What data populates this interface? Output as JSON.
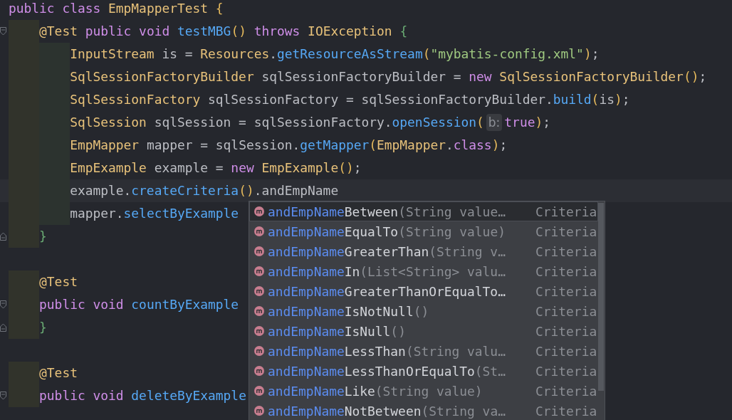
{
  "editor": {
    "lines": [
      {
        "tokens": [
          {
            "kind": "kw",
            "text": "public class "
          },
          {
            "kind": "type",
            "text": "EmpMapperTest "
          },
          {
            "kind": "brace-y",
            "text": "{"
          }
        ],
        "children": [
          {
            "fold_start": true,
            "tokens": [
              {
                "kind": "ann",
                "text": "@Test "
              },
              {
                "kind": "kw",
                "text": "public void "
              },
              {
                "kind": "method",
                "text": "testMBG"
              },
              {
                "kind": "paren",
                "text": "()"
              },
              {
                "kind": "kw",
                "text": " throws "
              },
              {
                "kind": "type",
                "text": "IOException "
              },
              {
                "kind": "brace-g",
                "text": "{"
              }
            ],
            "children": [
              {
                "tokens": [
                  {
                    "kind": "type",
                    "text": "InputStream "
                  },
                  {
                    "kind": "plain",
                    "text": "is = "
                  },
                  {
                    "kind": "type",
                    "text": "Resources"
                  },
                  {
                    "kind": "plain",
                    "text": "."
                  },
                  {
                    "kind": "method",
                    "text": "getResourceAsStream"
                  },
                  {
                    "kind": "paren",
                    "text": "("
                  },
                  {
                    "kind": "str",
                    "text": "\"mybatis-config.xml\""
                  },
                  {
                    "kind": "paren",
                    "text": ")"
                  },
                  {
                    "kind": "plain",
                    "text": ";"
                  }
                ]
              },
              {
                "tokens": [
                  {
                    "kind": "type",
                    "text": "SqlSessionFactoryBuilder "
                  },
                  {
                    "kind": "plain",
                    "text": "sqlSessionFactoryBuilder = "
                  },
                  {
                    "kind": "kw",
                    "text": "new "
                  },
                  {
                    "kind": "type",
                    "text": "SqlSessionFactoryBuilder"
                  },
                  {
                    "kind": "paren",
                    "text": "()"
                  },
                  {
                    "kind": "plain",
                    "text": ";"
                  }
                ]
              },
              {
                "tokens": [
                  {
                    "kind": "type",
                    "text": "SqlSessionFactory "
                  },
                  {
                    "kind": "plain",
                    "text": "sqlSessionFactory = sqlSessionFactoryBuilder."
                  },
                  {
                    "kind": "method",
                    "text": "build"
                  },
                  {
                    "kind": "paren",
                    "text": "("
                  },
                  {
                    "kind": "plain",
                    "text": "is"
                  },
                  {
                    "kind": "paren",
                    "text": ")"
                  },
                  {
                    "kind": "plain",
                    "text": ";"
                  }
                ]
              },
              {
                "tokens": [
                  {
                    "kind": "type",
                    "text": "SqlSession "
                  },
                  {
                    "kind": "plain",
                    "text": "sqlSession = sqlSessionFactory."
                  },
                  {
                    "kind": "method",
                    "text": "openSession"
                  },
                  {
                    "kind": "paren",
                    "text": "("
                  },
                  {
                    "kind": "hint",
                    "text": "b:"
                  },
                  {
                    "kind": "kw",
                    "text": "true"
                  },
                  {
                    "kind": "paren",
                    "text": ")"
                  },
                  {
                    "kind": "plain",
                    "text": ";"
                  }
                ]
              },
              {
                "tokens": [
                  {
                    "kind": "type",
                    "text": "EmpMapper "
                  },
                  {
                    "kind": "plain",
                    "text": "mapper = sqlSession."
                  },
                  {
                    "kind": "method",
                    "text": "getMapper"
                  },
                  {
                    "kind": "paren",
                    "text": "("
                  },
                  {
                    "kind": "type",
                    "text": "EmpMapper"
                  },
                  {
                    "kind": "plain",
                    "text": "."
                  },
                  {
                    "kind": "kw",
                    "text": "class"
                  },
                  {
                    "kind": "paren",
                    "text": ")"
                  },
                  {
                    "kind": "plain",
                    "text": ";"
                  }
                ]
              },
              {
                "tokens": [
                  {
                    "kind": "type",
                    "text": "EmpExample "
                  },
                  {
                    "kind": "plain",
                    "text": "example = "
                  },
                  {
                    "kind": "kw",
                    "text": "new "
                  },
                  {
                    "kind": "type",
                    "text": "EmpExample"
                  },
                  {
                    "kind": "paren",
                    "text": "()"
                  },
                  {
                    "kind": "plain",
                    "text": ";"
                  }
                ]
              },
              {
                "current": true,
                "tokens": [
                  {
                    "kind": "plain",
                    "text": "example."
                  },
                  {
                    "kind": "method",
                    "text": "createCriteria"
                  },
                  {
                    "kind": "paren",
                    "text": "()"
                  },
                  {
                    "kind": "plain",
                    "text": ".andEmpName"
                  }
                ]
              },
              {
                "tokens": [
                  {
                    "kind": "plain",
                    "text": "mapper."
                  },
                  {
                    "kind": "method",
                    "text": "selectByExample"
                  }
                ]
              }
            ]
          },
          {
            "fold_end": true,
            "tokens": [
              {
                "kind": "brace-g",
                "text": "}"
              }
            ]
          },
          {
            "kind": "blank"
          },
          {
            "tokens": [
              {
                "kind": "ann",
                "text": "@Test"
              }
            ]
          },
          {
            "fold_start": true,
            "tokens": [
              {
                "kind": "kw",
                "text": "public void "
              },
              {
                "kind": "method",
                "text": "countByExample"
              }
            ]
          },
          {
            "fold_end": true,
            "tokens": [
              {
                "kind": "brace-g",
                "text": "}"
              }
            ]
          },
          {
            "kind": "blank"
          },
          {
            "tokens": [
              {
                "kind": "ann",
                "text": "@Test"
              }
            ]
          },
          {
            "fold_start": true,
            "tokens": [
              {
                "kind": "kw",
                "text": "public void "
              },
              {
                "kind": "method",
                "text": "deleteByExample"
              }
            ]
          }
        ]
      }
    ]
  },
  "completion": {
    "items": [
      {
        "match": "andEmpName",
        "rest": "Between",
        "params": "(String value…",
        "type": "Criteria",
        "selected": true
      },
      {
        "match": "andEmpName",
        "rest": "EqualTo",
        "params": "(String value)",
        "type": "Criteria",
        "selected": false
      },
      {
        "match": "andEmpName",
        "rest": "GreaterThan",
        "params": "(String v…",
        "type": "Criteria",
        "selected": false
      },
      {
        "match": "andEmpName",
        "rest": "In",
        "params": "(List<String> valu…",
        "type": "Criteria",
        "selected": false
      },
      {
        "match": "andEmpName",
        "rest": "GreaterThanOrEqualTo…",
        "type": "Criteria",
        "selected": false
      },
      {
        "match": "andEmpName",
        "rest": "IsNotNull",
        "params": "()",
        "type": "Criteria",
        "selected": false
      },
      {
        "match": "andEmpName",
        "rest": "IsNull",
        "params": "()",
        "type": "Criteria",
        "selected": false
      },
      {
        "match": "andEmpName",
        "rest": "LessThan",
        "params": "(String valu…",
        "type": "Criteria",
        "selected": false
      },
      {
        "match": "andEmpName",
        "rest": "LessThanOrEqualTo",
        "params": "(St…",
        "type": "Criteria",
        "selected": false
      },
      {
        "match": "andEmpName",
        "rest": "Like",
        "params": "(String value)",
        "type": "Criteria",
        "selected": false
      },
      {
        "match": "andEmpName",
        "rest": "NotBetween",
        "params": "(String va…",
        "type": "Criteria",
        "selected": false
      }
    ]
  }
}
